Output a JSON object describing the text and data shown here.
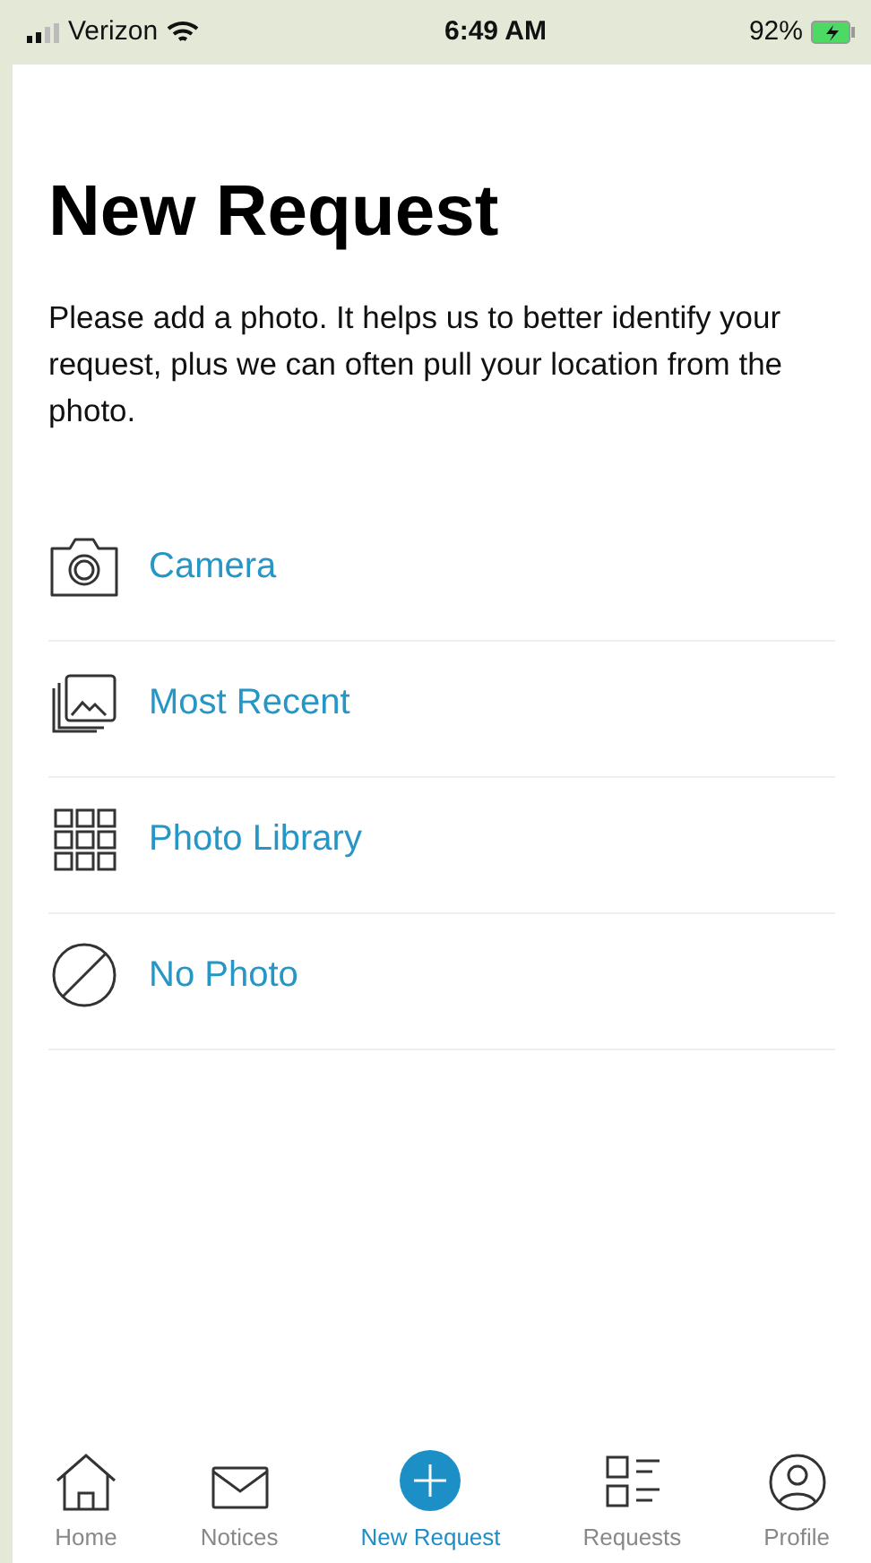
{
  "status_bar": {
    "carrier": "Verizon",
    "time": "6:49 AM",
    "battery": "92%"
  },
  "title": "New Request",
  "description": "Please add a photo. It helps us to better identify your request, plus we can often pull your location from the photo.",
  "options": [
    {
      "kind": "camera",
      "label": "Camera"
    },
    {
      "kind": "recent",
      "label": "Most Recent"
    },
    {
      "kind": "library",
      "label": "Photo Library"
    },
    {
      "kind": "none",
      "label": "No Photo"
    }
  ],
  "tab_bar": [
    {
      "kind": "home",
      "label": "Home",
      "selected": false
    },
    {
      "kind": "notices",
      "label": "Notices",
      "selected": false
    },
    {
      "kind": "new",
      "label": "New Request",
      "selected": true
    },
    {
      "kind": "requests",
      "label": "Requests",
      "selected": false
    },
    {
      "kind": "profile",
      "label": "Profile",
      "selected": false
    }
  ]
}
